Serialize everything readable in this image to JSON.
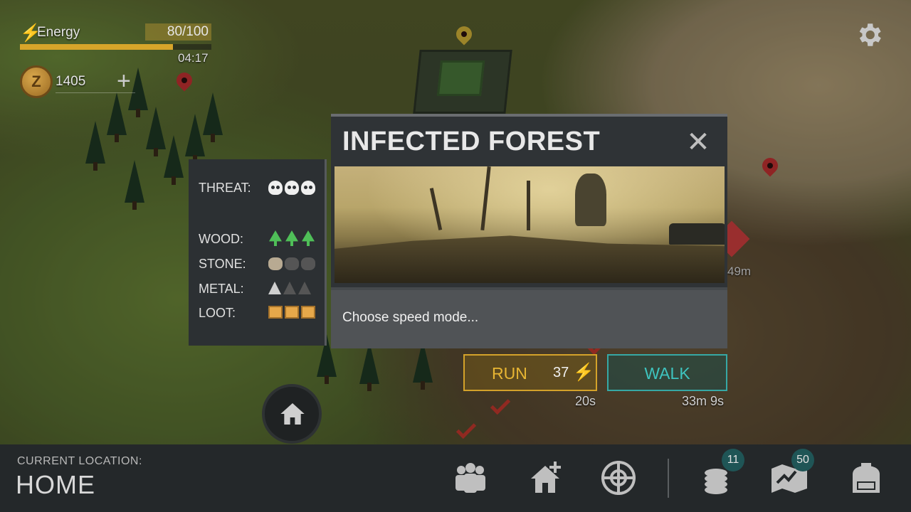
{
  "hud": {
    "energy_label": "Energy",
    "energy_value": "80/100",
    "energy_fraction": 0.8,
    "energy_timer": "04:17",
    "coins": "1405",
    "coin_plus": "+",
    "coin_symbol": "Z"
  },
  "map": {
    "distance_label": "49m"
  },
  "location": {
    "title": "INFECTED FOREST",
    "close_glyph": "✕",
    "prompt": "Choose speed mode...",
    "stats": {
      "threat_label": "THREAT:",
      "threat_level": 3,
      "wood_label": "WOOD:",
      "wood_level": 3,
      "stone_label": "STONE:",
      "stone_level": 1,
      "metal_label": "METAL:",
      "metal_level": 1,
      "loot_label": "LOOT:",
      "loot_level": 3
    }
  },
  "travel": {
    "run_label": "RUN",
    "run_cost": "37",
    "run_time": "20s",
    "walk_label": "WALK",
    "walk_time": "33m 9s"
  },
  "bottom_bar": {
    "location_caption": "CURRENT LOCATION:",
    "location_name": "HOME",
    "nav": [
      {
        "icon": "clan-icon"
      },
      {
        "icon": "add-base-icon"
      },
      {
        "icon": "crosshair-icon"
      },
      {
        "icon": "coins-icon",
        "badge": "11"
      },
      {
        "icon": "blueprint-map-icon",
        "badge": "50"
      },
      {
        "icon": "backpack-icon"
      }
    ]
  },
  "colors": {
    "energy": "#d7a52a",
    "run_accent": "#d4a22a",
    "walk_accent": "#36a8a5",
    "wood_icon": "#4fbf58",
    "loot_icon": "#e6a84a"
  }
}
